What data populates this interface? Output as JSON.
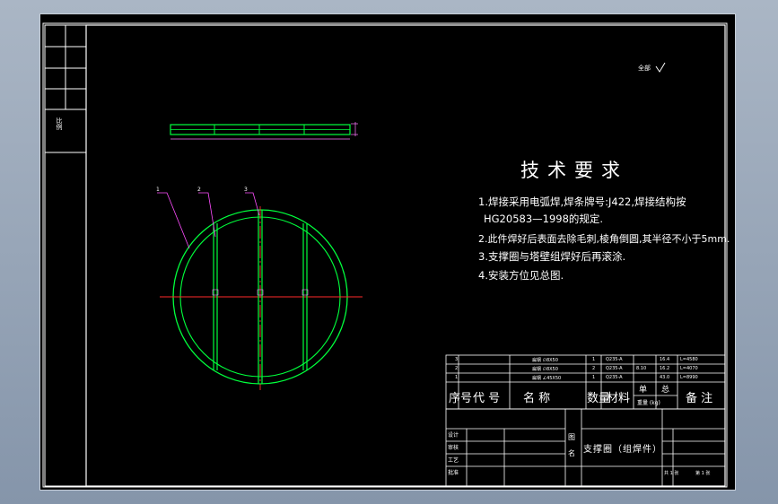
{
  "drawing": {
    "title_block": {
      "part_name": "支撑圈（组焊件）",
      "field_labels": {
        "drafted": "设计",
        "checked": "审核",
        "process": "工艺",
        "approved": "批准",
        "scale_mark": "图",
        "name_mark": "名"
      },
      "roughness_note": "全部"
    },
    "side_stamp": "比例",
    "tech_requirements": {
      "heading": "技术要求",
      "items": [
        "1.焊接采用电弧焊,焊条牌号:J422,焊接结构按",
        "HG20583—1998的规定.",
        "2.此件焊好后表面去除毛刺,棱角倒圆,其半径不小于5mm.",
        "3.支撑圈与塔壁组焊好后再滚涂.",
        "4.安装方位见总图."
      ]
    },
    "bom": {
      "header": {
        "seq": "序号",
        "code": "代  号",
        "name": "名    称",
        "qty": "数量",
        "material": "材料",
        "unit_weight": "单",
        "total_weight": "总",
        "weight_unit": "重量 (kg)",
        "remarks": "备  注"
      },
      "rows": [
        {
          "seq": "3",
          "name": "扁钢 ∅8X50",
          "qty": "1",
          "material": "Q235-A",
          "unit": "",
          "total": "16.4",
          "remark": "L=4580"
        },
        {
          "seq": "2",
          "name": "扁钢 ∅8X50",
          "qty": "2",
          "material": "Q235-A",
          "unit": "8.10",
          "total": "16.2",
          "remark": "L=4070"
        },
        {
          "seq": "1",
          "name": "扁钢 ∠45X50",
          "qty": "1",
          "material": "Q235-A",
          "unit": "",
          "total": "43.0",
          "remark": "L=8990"
        }
      ]
    },
    "balloons": [
      "1",
      "2",
      "3"
    ],
    "footer_cells": {
      "sheet": "共 1 张",
      "page": "第 1 张"
    }
  },
  "colors": {
    "background": "#000000",
    "frame": "#ffffff",
    "part_green": "#00ff3c",
    "center_red": "#ff2a2a",
    "leader_magenta": "#ff4dff",
    "dim_cyan": "#ff7aff"
  }
}
